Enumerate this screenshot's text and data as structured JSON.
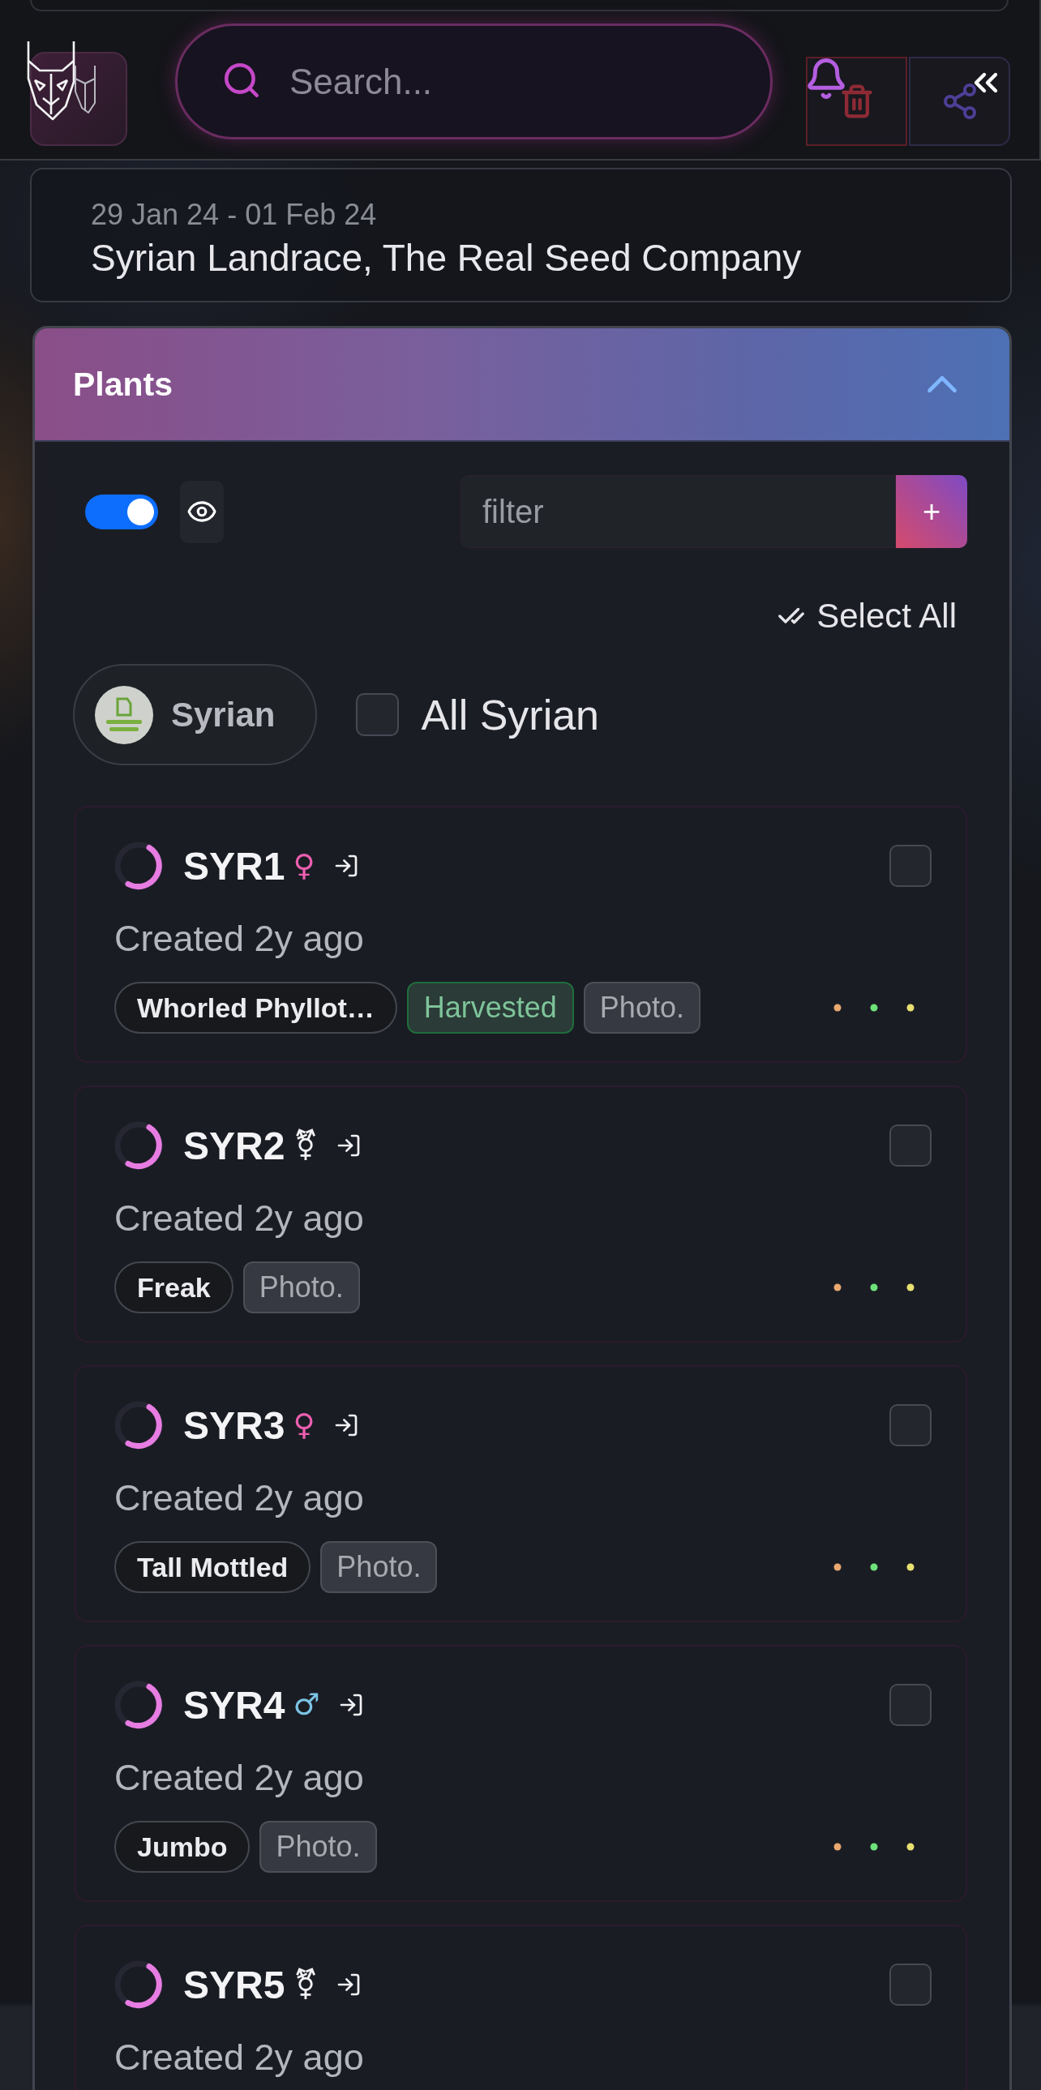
{
  "header": {
    "search": {
      "placeholder": "Search..."
    }
  },
  "info_card": {
    "date_range": "29 Jan 24 - 01 Feb 24",
    "title": "Syrian Landrace, The Real Seed Company"
  },
  "plants_panel": {
    "title": "Plants",
    "expanded": true,
    "visibility_toggle": {
      "on": true
    },
    "filter": {
      "placeholder": "filter"
    },
    "add_button": "+",
    "select_all": "Select All",
    "group": {
      "name": "Syrian",
      "checkbox": {
        "label": "All Syrian",
        "checked": false
      }
    },
    "plants": [
      {
        "name": "SYR1",
        "sex": {
          "symbol": "♀",
          "color": "#ec5fb0"
        },
        "checked": false,
        "created": "Created 2y ago",
        "tags": [
          {
            "kind": "strain",
            "label": "Whorled Phyllot…"
          },
          {
            "kind": "status",
            "label": "Harvested"
          },
          {
            "kind": "type",
            "label": "Photo."
          }
        ]
      },
      {
        "name": "SYR2",
        "sex": {
          "symbol": "⚧",
          "color": "#f2f2f4"
        },
        "checked": false,
        "created": "Created 2y ago",
        "tags": [
          {
            "kind": "strain",
            "label": "Freak"
          },
          {
            "kind": "type",
            "label": "Photo."
          }
        ]
      },
      {
        "name": "SYR3",
        "sex": {
          "symbol": "♀",
          "color": "#ec5fb0"
        },
        "checked": false,
        "created": "Created 2y ago",
        "tags": [
          {
            "kind": "strain",
            "label": "Tall Mottled"
          },
          {
            "kind": "type",
            "label": "Photo."
          }
        ]
      },
      {
        "name": "SYR4",
        "sex": {
          "symbol": "♂",
          "color": "#7cc4e6"
        },
        "checked": false,
        "created": "Created 2y ago",
        "tags": [
          {
            "kind": "strain",
            "label": "Jumbo"
          },
          {
            "kind": "type",
            "label": "Photo."
          }
        ]
      },
      {
        "name": "SYR5",
        "sex": {
          "symbol": "⚧",
          "color": "#f2f2f4"
        },
        "checked": false,
        "created": "Created 2y ago"
      }
    ]
  }
}
